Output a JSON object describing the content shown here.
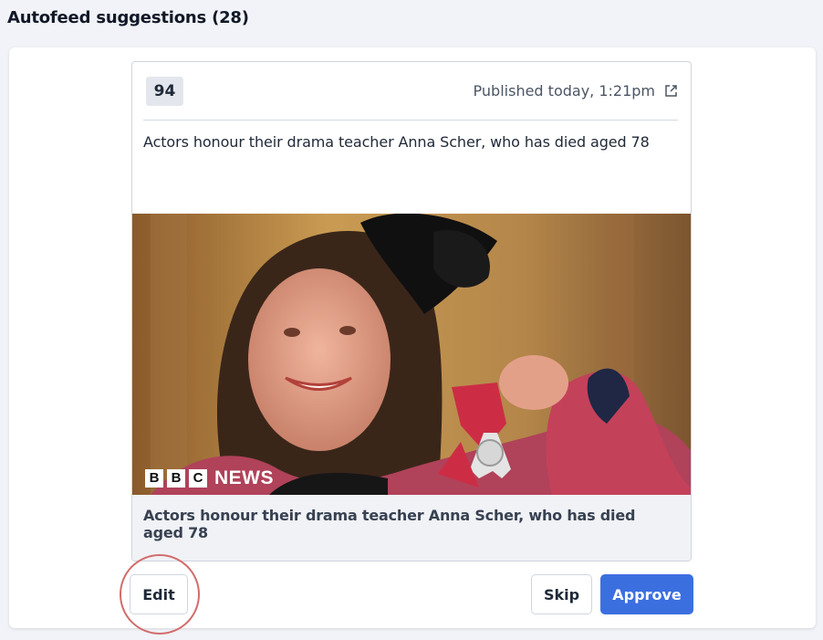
{
  "heading": "Autofeed suggestions (28)",
  "card": {
    "score": "94",
    "published": "Published today, 1:21pm",
    "headline": "Actors honour their drama teacher Anna Scher, who has died aged 78",
    "image_brand": {
      "letters": [
        "B",
        "B",
        "C"
      ],
      "word": "NEWS"
    },
    "caption": "Actors honour their drama teacher Anna Scher, who has died aged 78"
  },
  "actions": {
    "edit_label": "Edit",
    "skip_label": "Skip",
    "approve_label": "Approve"
  },
  "icons": {
    "external_link": "external-link-icon"
  },
  "colors": {
    "approve": "#3b6fe0",
    "highlight": "#d36b6b",
    "badge_bg": "#e3e7ed"
  }
}
